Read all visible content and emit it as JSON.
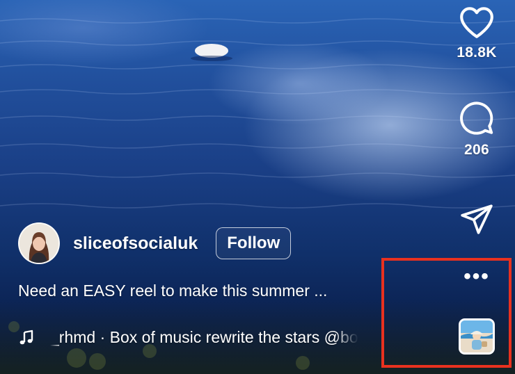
{
  "reel": {
    "author": {
      "username": "sliceofsocialuk",
      "follow_label": "Follow"
    },
    "caption": "Need an EASY reel to make this summer ...",
    "music": {
      "icon": "music-note-icon",
      "text": "_rhmd · Box of music rewrite the stars @bo"
    }
  },
  "actions": {
    "like": {
      "icon": "heart-icon",
      "count": "18.8K"
    },
    "comment": {
      "icon": "comment-bubble-icon",
      "count": "206"
    },
    "share": {
      "icon": "paper-plane-icon"
    },
    "more": {
      "icon": "more-horizontal-icon",
      "label": "•••"
    },
    "audio": {
      "icon": "audio-thumbnail"
    }
  },
  "colors": {
    "highlight": "#e8311f",
    "text": "#ffffff"
  }
}
